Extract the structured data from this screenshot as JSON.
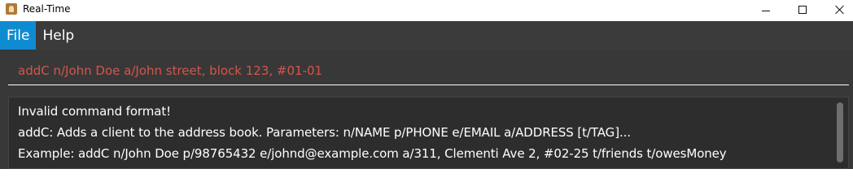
{
  "window": {
    "title": "Real-Time",
    "icon": "app-person-icon",
    "controls": [
      "minimize-icon",
      "maximize-icon",
      "close-icon"
    ]
  },
  "menu": {
    "items": [
      {
        "label": "File",
        "active": true
      },
      {
        "label": "Help",
        "active": false
      }
    ]
  },
  "command": {
    "value": "addC n/John Doe a/John street, block 123, #01-01",
    "color": "#d2564d"
  },
  "result": {
    "lines": [
      "Invalid command format!",
      "addC: Adds a client to the address book. Parameters: n/NAME p/PHONE e/EMAIL a/ADDRESS [t/TAG]...",
      "Example: addC n/John Doe p/98765432 e/johnd@example.com a/311, Clementi Ave 2, #02-25 t/friends t/owesMoney"
    ]
  },
  "colors": {
    "menu_active": "#0f8bd1",
    "background_dark": "#383838",
    "result_background": "#2d2d2d"
  }
}
